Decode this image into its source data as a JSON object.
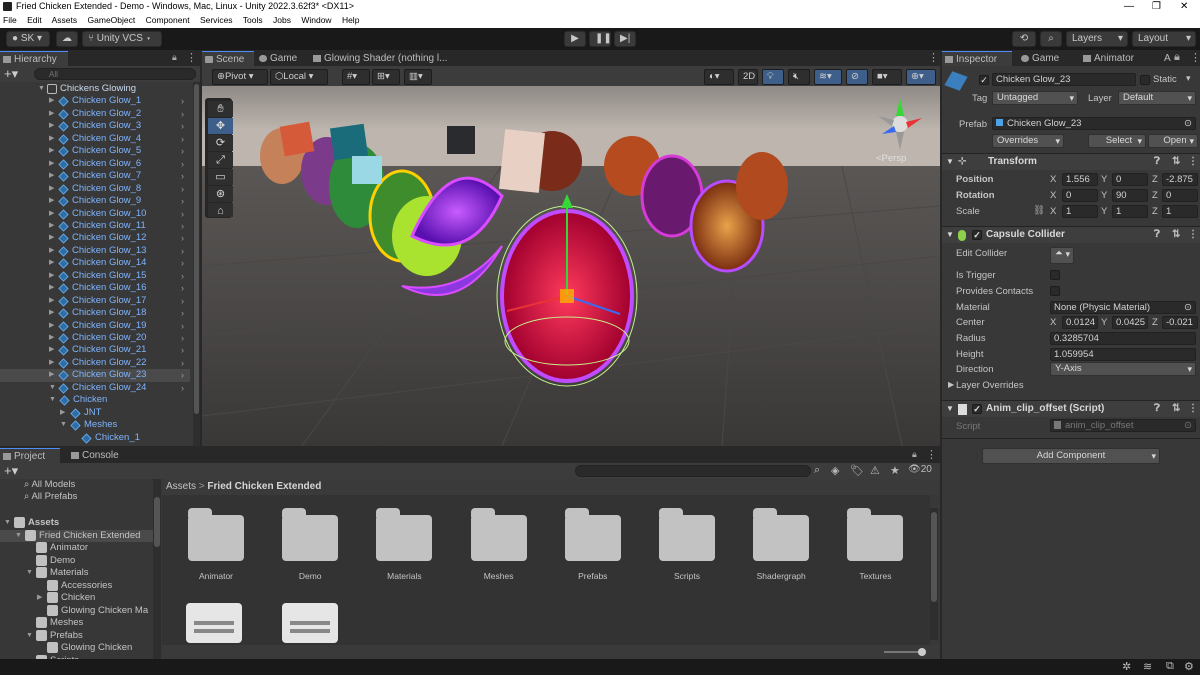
{
  "window": {
    "title": "Fried Chicken Extended - Demo - Windows, Mac, Linux - Unity 2022.3.62f3* <DX11>",
    "minimize": "—",
    "maximize": "❐",
    "close": "✕"
  },
  "menu": [
    "File",
    "Edit",
    "Assets",
    "GameObject",
    "Component",
    "Services",
    "Tools",
    "Jobs",
    "Window",
    "Help"
  ],
  "toolbar": {
    "account": "SK",
    "vcs": "Unity VCS",
    "layers": "Layers",
    "layout": "Layout"
  },
  "hierarchy": {
    "tab": "Hierarchy",
    "search_placeholder": "All",
    "root": "Chickens Glowing",
    "items": [
      "Chicken Glow_1",
      "Chicken Glow_2",
      "Chicken Glow_3",
      "Chicken Glow_4",
      "Chicken Glow_5",
      "Chicken Glow_6",
      "Chicken Glow_7",
      "Chicken Glow_8",
      "Chicken Glow_9",
      "Chicken Glow_10",
      "Chicken Glow_11",
      "Chicken Glow_12",
      "Chicken Glow_13",
      "Chicken Glow_14",
      "Chicken Glow_15",
      "Chicken Glow_16",
      "Chicken Glow_17",
      "Chicken Glow_18",
      "Chicken Glow_19",
      "Chicken Glow_20",
      "Chicken Glow_21",
      "Chicken Glow_22",
      "Chicken Glow_23",
      "Chicken Glow_24"
    ],
    "children": [
      "Chicken",
      "JNT",
      "Meshes",
      "Chicken_1"
    ]
  },
  "scene": {
    "tabs": [
      "Scene",
      "Game",
      "Glowing Shader (nothing l..."
    ],
    "pivot": "Pivot",
    "local": "Local",
    "mode_2d": "2D",
    "persp": "<Persp"
  },
  "inspector": {
    "tabs": [
      "Inspector",
      "Game",
      "Animator",
      "A"
    ],
    "object_name": "Chicken Glow_23",
    "static": "Static",
    "tag_label": "Tag",
    "tag": "Untagged",
    "layer_label": "Layer",
    "layer": "Default",
    "prefab_label": "Prefab",
    "prefab": "Chicken Glow_23",
    "overrides": "Overrides",
    "select": "Select",
    "open": "Open",
    "transform": {
      "title": "Transform",
      "position_label": "Position",
      "position": [
        "1.556",
        "0",
        "-2.875"
      ],
      "rotation_label": "Rotation",
      "rotation": [
        "0",
        "90",
        "0"
      ],
      "scale_label": "Scale",
      "scale": [
        "1",
        "1",
        "1"
      ]
    },
    "capsule": {
      "title": "Capsule Collider",
      "edit_collider": "Edit Collider",
      "is_trigger": "Is Trigger",
      "provides_contacts": "Provides Contacts",
      "material_label": "Material",
      "material": "None (Physic Material)",
      "center_label": "Center",
      "center": [
        "0.0124",
        "0.0425",
        "-0.021"
      ],
      "radius_label": "Radius",
      "radius": "0.3285704",
      "height_label": "Height",
      "height": "1.059954",
      "direction_label": "Direction",
      "direction": "Y-Axis",
      "layer_overrides": "Layer Overrides"
    },
    "script": {
      "title": "Anim_clip_offset (Script)",
      "script_label": "Script",
      "script": "anim_clip_offset"
    },
    "add_component": "Add Component"
  },
  "project": {
    "tabs": [
      "Project",
      "Console"
    ],
    "favorites": [
      "All Models",
      "All Prefabs"
    ],
    "tree": [
      {
        "label": "Assets",
        "indent": 0,
        "bold": true
      },
      {
        "label": "Fried Chicken Extended",
        "indent": 1
      },
      {
        "label": "Animator",
        "indent": 2
      },
      {
        "label": "Demo",
        "indent": 2
      },
      {
        "label": "Materials",
        "indent": 2
      },
      {
        "label": "Accessories",
        "indent": 3
      },
      {
        "label": "Chicken",
        "indent": 3
      },
      {
        "label": "Glowing Chicken Ma",
        "indent": 3
      },
      {
        "label": "Meshes",
        "indent": 2
      },
      {
        "label": "Prefabs",
        "indent": 2
      },
      {
        "label": "Glowing Chicken",
        "indent": 3
      },
      {
        "label": "Scripts",
        "indent": 2
      }
    ],
    "breadcrumb": [
      "Assets",
      "Fried Chicken Extended"
    ],
    "folders": [
      "Animator",
      "Demo",
      "Materials",
      "Meshes",
      "Prefabs",
      "Scripts",
      "Shadergraph",
      "Textures"
    ],
    "hidden_count": "20"
  },
  "colors": {
    "accent": "#4c8ef7",
    "selection": "#2c5d87",
    "hierarchy_text": "#7eb4ff"
  }
}
